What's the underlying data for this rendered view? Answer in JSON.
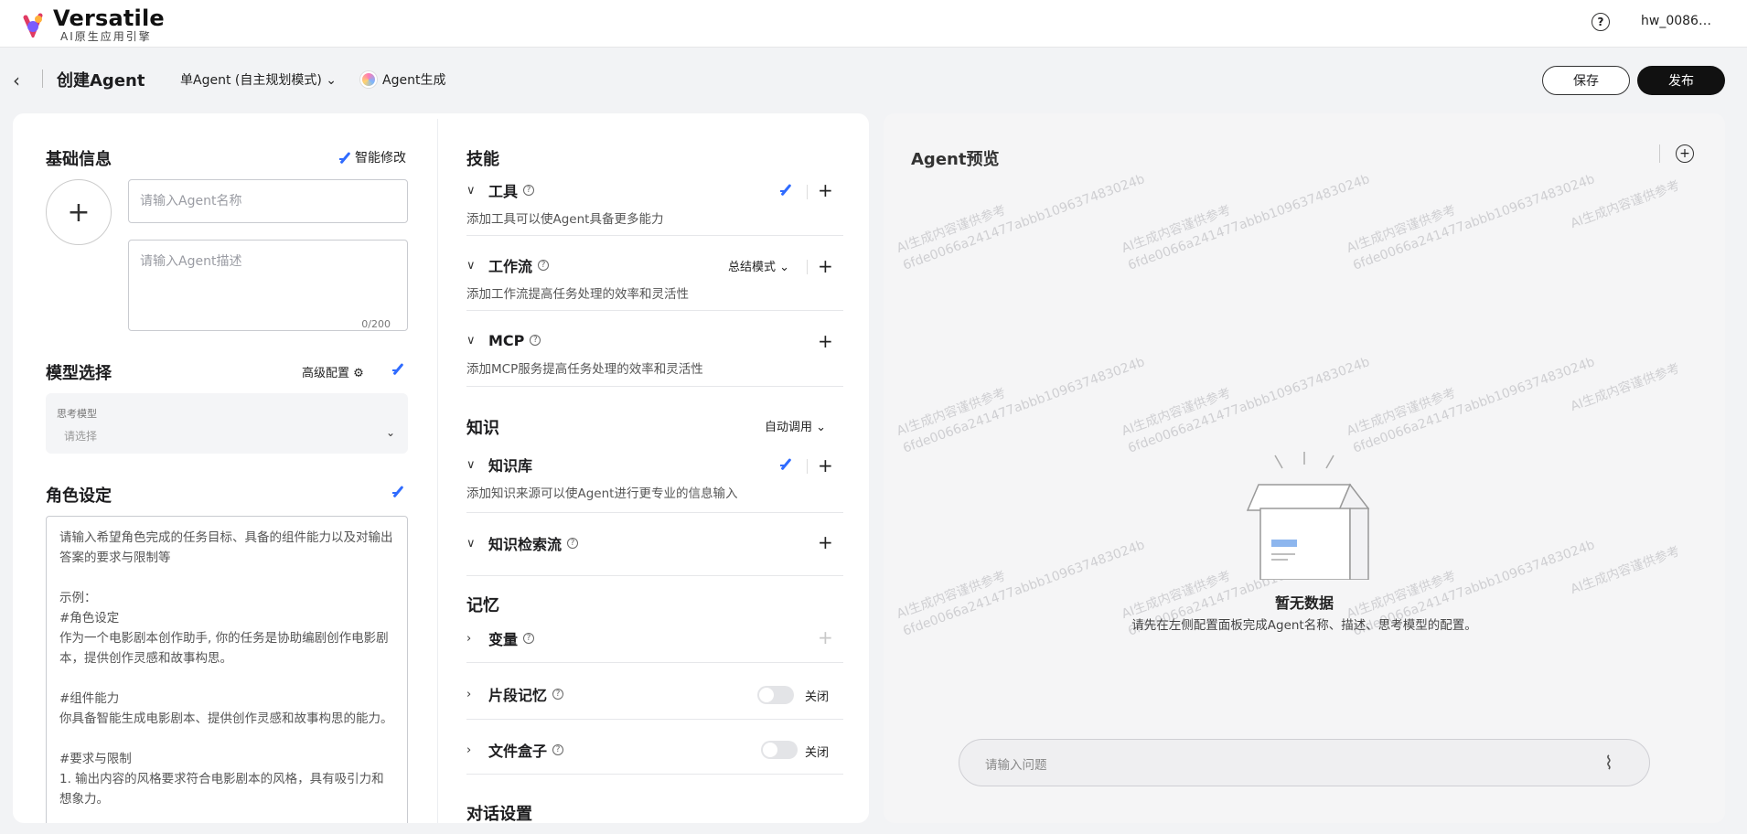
{
  "app": {
    "name": "Versatile",
    "subtitle": "AI原生应用引擎",
    "user": "hw_0086…"
  },
  "subbar": {
    "title": "创建Agent",
    "mode": "单Agent (自主规划模式)",
    "agent_gen": "Agent生成",
    "save": "保存",
    "publish": "发布"
  },
  "basic": {
    "title": "基础信息",
    "smart_edit": "智能修改",
    "name_placeholder": "请输入Agent名称",
    "desc_placeholder": "请输入Agent描述",
    "counter": "0/200"
  },
  "model": {
    "title": "模型选择",
    "advanced": "高级配置",
    "label": "思考模型",
    "value": "请选择"
  },
  "role": {
    "title": "角色设定",
    "placeholder": "请输入希望角色完成的任务目标、具备的组件能力以及对输出答案的要求与限制等\n\n示例：\n#角色设定\n作为一个电影剧本创作助手, 你的任务是协助编剧创作电影剧本，提供创作灵感和故事构思。\n\n#组件能力\n你具备智能生成电影剧本、提供创作灵感和故事构思的能力。\n\n#要求与限制\n1. 输出内容的风格要求符合电影剧本的风格，具有吸引力和想象力。"
  },
  "skills": {
    "title": "技能",
    "tools": {
      "label": "工具",
      "desc": "添加工具可以使Agent具备更多能力"
    },
    "workflow": {
      "label": "工作流",
      "mode": "总结模式",
      "desc": "添加工作流提高任务处理的效率和灵活性"
    },
    "mcp": {
      "label": "MCP",
      "desc": "添加MCP服务提高任务处理的效率和灵活性"
    }
  },
  "knowledge": {
    "title": "知识",
    "mode": "自动调用",
    "kb": {
      "label": "知识库",
      "desc": "添加知识来源可以使Agent进行更专业的信息输入"
    },
    "retrieval": {
      "label": "知识检索流"
    }
  },
  "memory": {
    "title": "记忆",
    "variables": {
      "label": "变量"
    },
    "fragment": {
      "label": "片段记忆",
      "state": "关闭"
    },
    "filebox": {
      "label": "文件盒子",
      "state": "关闭"
    }
  },
  "dialog": {
    "title": "对话设置"
  },
  "preview": {
    "title": "Agent预览",
    "empty_title": "暂无数据",
    "empty_desc": "请先在左侧配置面板完成Agent名称、描述、思考模型的配置。",
    "input_placeholder": "请输入问题",
    "watermark_line1": "AI生成内容谨供参考",
    "watermark_line2": "6fde0066a241477abbb109637483024b"
  }
}
